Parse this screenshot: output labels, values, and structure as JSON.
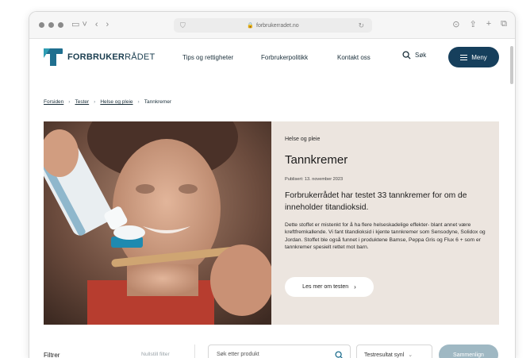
{
  "browser": {
    "url": "forbrukerradet.no",
    "icons": [
      "traffic-lights",
      "sidebar-icon",
      "back-icon",
      "forward-icon",
      "shield-icon",
      "lock-icon",
      "reload-icon",
      "download-icon",
      "share-icon",
      "new-tab-icon",
      "tabs-icon"
    ]
  },
  "site": {
    "logo_bold": "FORBRUKER",
    "logo_light": "RÅDET",
    "nav": [
      "Tips og rettigheter",
      "Forbrukerpolitikk",
      "Kontakt oss"
    ],
    "search_label": "Søk",
    "menu_label": "Meny",
    "brand_color": "#163f5c"
  },
  "breadcrumb": {
    "items": [
      "Forsiden",
      "Tester",
      "Helse og pleie",
      "Tannkremer"
    ]
  },
  "article": {
    "category": "Helse og pleie",
    "title": "Tannkremer",
    "published": "Publisert: 13. november 2023",
    "lead": "Forbrukerrådet har testet 33 tannkremer for om de inneholder titandioksid.",
    "body": "Dette stoffet er mistenkt for å ha flere helseskadelige effekter- blant annet være kreftfremkallende. Vi fant titandioksid i kjente tannkremer som Sensodyne, Solidox og Jordan. Stoffet ble også funnet i produktene Bamse, Peppa Gris og Flux 6 + som er tannkremer spesielt rettet mot barn.",
    "more_button": "Les mer om testen",
    "panel_color": "#ece5df"
  },
  "filters": {
    "label": "Filtrer",
    "reset": "Nullstill filter",
    "search_placeholder": "Søk etter produkt",
    "sort_selected": "Testresultat synl",
    "compare_button": "Sammenlign"
  }
}
